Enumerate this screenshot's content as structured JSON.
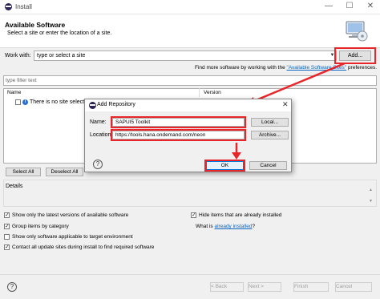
{
  "window": {
    "title": "Install",
    "minimize_glyph": "—",
    "maximize_glyph": "☐",
    "close_glyph": "✕"
  },
  "header": {
    "title": "Available Software",
    "description": "Select a site or enter the location of a site."
  },
  "work_with": {
    "label": "Work with:",
    "value": "type or select a site",
    "add_label": "Add...",
    "find_more_prefix": "Find more software by working with the ",
    "find_more_link": "\"Available Software Sites\"",
    "find_more_suffix": " preferences."
  },
  "filter": {
    "placeholder": "type filter text"
  },
  "tree": {
    "columns": [
      "Name",
      "Version"
    ],
    "message": "There is no site selected."
  },
  "selection_buttons": {
    "select_all": "Select All",
    "deselect_all": "Deselect All"
  },
  "details": {
    "label": "Details"
  },
  "options_left": [
    {
      "label": "Show only the latest versions of available software",
      "checked": true
    },
    {
      "label": "Group items by category",
      "checked": true
    },
    {
      "label": "Show only software applicable to target environment",
      "checked": false
    },
    {
      "label": "Contact all update sites during install to find required software",
      "checked": true
    }
  ],
  "options_right": {
    "hide_installed": {
      "label": "Hide items that are already installed",
      "checked": true
    },
    "what_is_prefix": "What is ",
    "what_is_link": "already installed",
    "what_is_suffix": "?"
  },
  "footer": {
    "help": "?",
    "back": "< Back",
    "next": "Next >",
    "finish": "Finish",
    "cancel": "Cancel"
  },
  "dialog": {
    "title": "Add Repository",
    "name_label": "Name:",
    "name_value": "SAPUI5 Toolkit",
    "location_label": "Location:",
    "location_value": "https://tools.hana.ondemand.com/neon",
    "local_button": "Local...",
    "archive_button": "Archive...",
    "help": "?",
    "ok": "OK",
    "cancel": "Cancel"
  },
  "icons": {
    "app": "eclipse-icon",
    "header": "software-install-icon",
    "info": "info-icon",
    "help": "help-icon"
  },
  "colors": {
    "highlight": "#e8262a",
    "link": "#0a66c2",
    "ok_border": "#0078d7"
  }
}
